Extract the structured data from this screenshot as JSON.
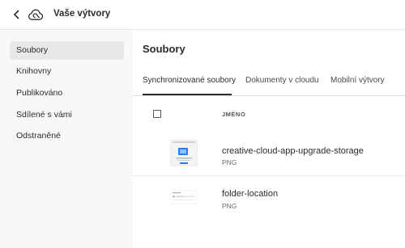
{
  "header": {
    "title": "Vaše výtvory",
    "back_icon": "chevron-left-icon",
    "logo_icon": "creative-cloud-logo-icon"
  },
  "sidebar": {
    "items": [
      {
        "label": "Soubory",
        "active": true
      },
      {
        "label": "Knihovny",
        "active": false
      },
      {
        "label": "Publikováno",
        "active": false
      },
      {
        "label": "Sdílené s vámi",
        "active": false
      },
      {
        "label": "Odstraněné",
        "active": false
      }
    ]
  },
  "main": {
    "title": "Soubory",
    "tabs": [
      {
        "label": "Synchronizované soubory",
        "active": true
      },
      {
        "label": "Dokumenty v cloudu",
        "active": false
      },
      {
        "label": "Mobilní výtvory",
        "active": false
      }
    ],
    "table": {
      "column_name": "JMÉNO",
      "rows": [
        {
          "name": "creative-cloud-app-upgrade-storage",
          "type": "PNG"
        },
        {
          "name": "folder-location",
          "type": "PNG"
        }
      ]
    }
  },
  "colors": {
    "sidebar_bg": "#f8f8f8",
    "active_item_bg": "#e8e8e8",
    "text": "#2c2c2c",
    "thumb_accent": "#2680eb"
  }
}
